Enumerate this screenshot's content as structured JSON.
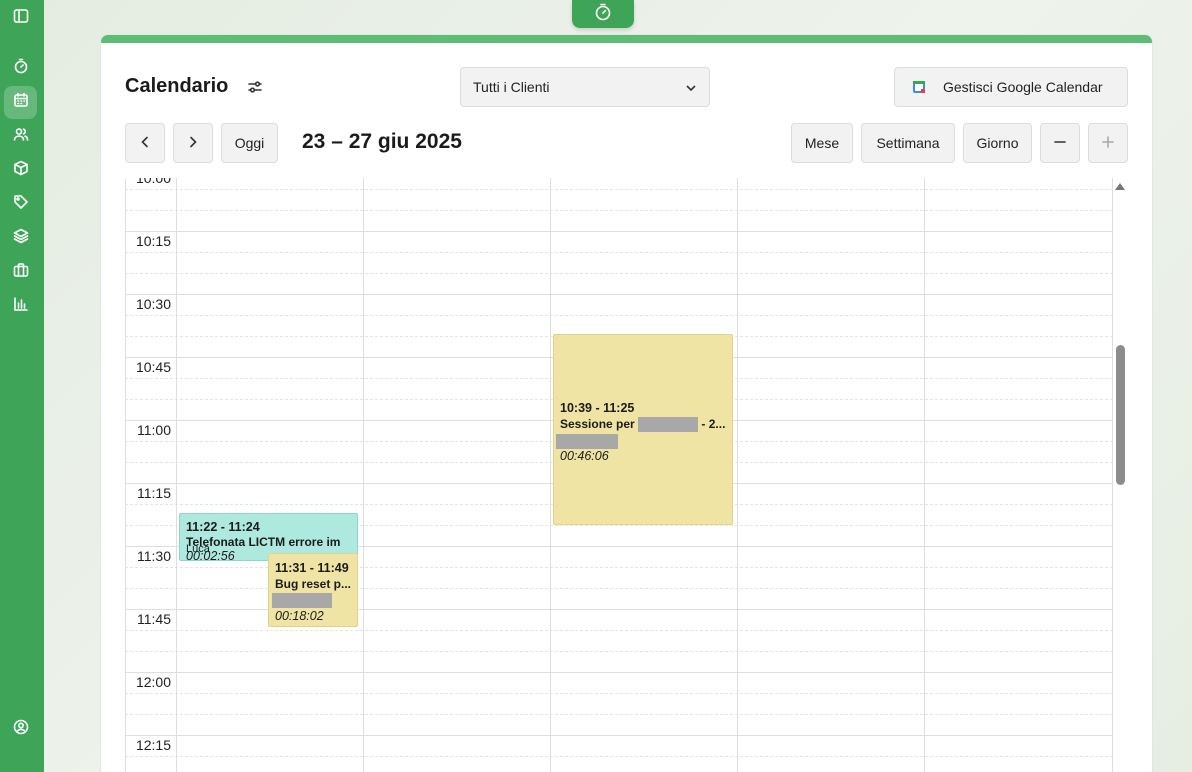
{
  "sidebar": {
    "items": [
      {
        "name": "sidebar-toggle",
        "icon": "sidebar-toggle-icon"
      },
      {
        "name": "timer",
        "icon": "stopwatch-icon"
      },
      {
        "name": "calendar",
        "icon": "calendar-icon",
        "active": true
      },
      {
        "name": "clients",
        "icon": "users-icon"
      },
      {
        "name": "products",
        "icon": "box-icon"
      },
      {
        "name": "tags",
        "icon": "tag-icon"
      },
      {
        "name": "projects",
        "icon": "layers-icon"
      },
      {
        "name": "work",
        "icon": "briefcase-icon"
      },
      {
        "name": "reports",
        "icon": "bar-chart-icon"
      },
      {
        "name": "account",
        "icon": "user-circle-icon"
      }
    ]
  },
  "timer_tab": {
    "icon": "stopwatch-icon"
  },
  "header": {
    "title": "Calendario",
    "client_select": {
      "value": "Tutti i Clienti"
    },
    "google_button": "Gestisci Google Calendar"
  },
  "toolbar": {
    "today": "Oggi",
    "date_range": "23 – 27 giu 2025",
    "views": {
      "month": "Mese",
      "week": "Settimana",
      "day": "Giorno"
    }
  },
  "grid": {
    "times": [
      "10:00",
      "10:15",
      "10:30",
      "10:45",
      "11:00",
      "11:15",
      "11:30",
      "11:45",
      "12:00",
      "12:15"
    ]
  },
  "events": [
    {
      "time": "11:22 - 11:24",
      "title": "Telefonata LICTM errore im",
      "subtitle": "Luca",
      "duration": "00:02:56",
      "color": "#aee9df"
    },
    {
      "time": "11:31 - 11:49",
      "title": "Bug reset p...",
      "duration": "00:18:02",
      "color": "#f0e4a4"
    },
    {
      "time": "10:39 - 11:25",
      "title_prefix": "Sessione per",
      "title_suffix": "- 2...",
      "duration": "00:46:06",
      "color": "#f0e4a4"
    }
  ],
  "colors": {
    "brand_green": "#3da458",
    "top_bar": "#5ebd74"
  }
}
